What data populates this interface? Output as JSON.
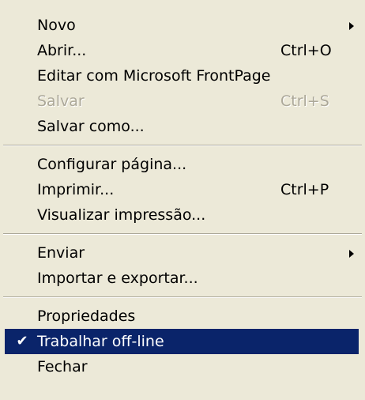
{
  "menu": {
    "colors": {
      "background": "#ece9d8",
      "highlight": "#0a246a",
      "highlight_text": "#ffffff",
      "disabled_text": "#aca899"
    },
    "groups": [
      [
        {
          "label": "Novo",
          "shortcut": "",
          "submenu": true,
          "enabled": true,
          "checked": false,
          "selected": false
        },
        {
          "label": "Abrir...",
          "shortcut": "Ctrl+O",
          "submenu": false,
          "enabled": true,
          "checked": false,
          "selected": false
        },
        {
          "label": "Editar com Microsoft FrontPage",
          "shortcut": "",
          "submenu": false,
          "enabled": true,
          "checked": false,
          "selected": false
        },
        {
          "label": "Salvar",
          "shortcut": "Ctrl+S",
          "submenu": false,
          "enabled": false,
          "checked": false,
          "selected": false
        },
        {
          "label": "Salvar como...",
          "shortcut": "",
          "submenu": false,
          "enabled": true,
          "checked": false,
          "selected": false
        }
      ],
      [
        {
          "label": "Configurar página...",
          "shortcut": "",
          "submenu": false,
          "enabled": true,
          "checked": false,
          "selected": false
        },
        {
          "label": "Imprimir...",
          "shortcut": "Ctrl+P",
          "submenu": false,
          "enabled": true,
          "checked": false,
          "selected": false
        },
        {
          "label": "Visualizar impressão...",
          "shortcut": "",
          "submenu": false,
          "enabled": true,
          "checked": false,
          "selected": false
        }
      ],
      [
        {
          "label": "Enviar",
          "shortcut": "",
          "submenu": true,
          "enabled": true,
          "checked": false,
          "selected": false
        },
        {
          "label": "Importar e exportar...",
          "shortcut": "",
          "submenu": false,
          "enabled": true,
          "checked": false,
          "selected": false
        }
      ],
      [
        {
          "label": "Propriedades",
          "shortcut": "",
          "submenu": false,
          "enabled": true,
          "checked": false,
          "selected": false
        },
        {
          "label": "Trabalhar off-line",
          "shortcut": "",
          "submenu": false,
          "enabled": true,
          "checked": true,
          "selected": true
        },
        {
          "label": "Fechar",
          "shortcut": "",
          "submenu": false,
          "enabled": true,
          "checked": false,
          "selected": false
        }
      ]
    ]
  }
}
